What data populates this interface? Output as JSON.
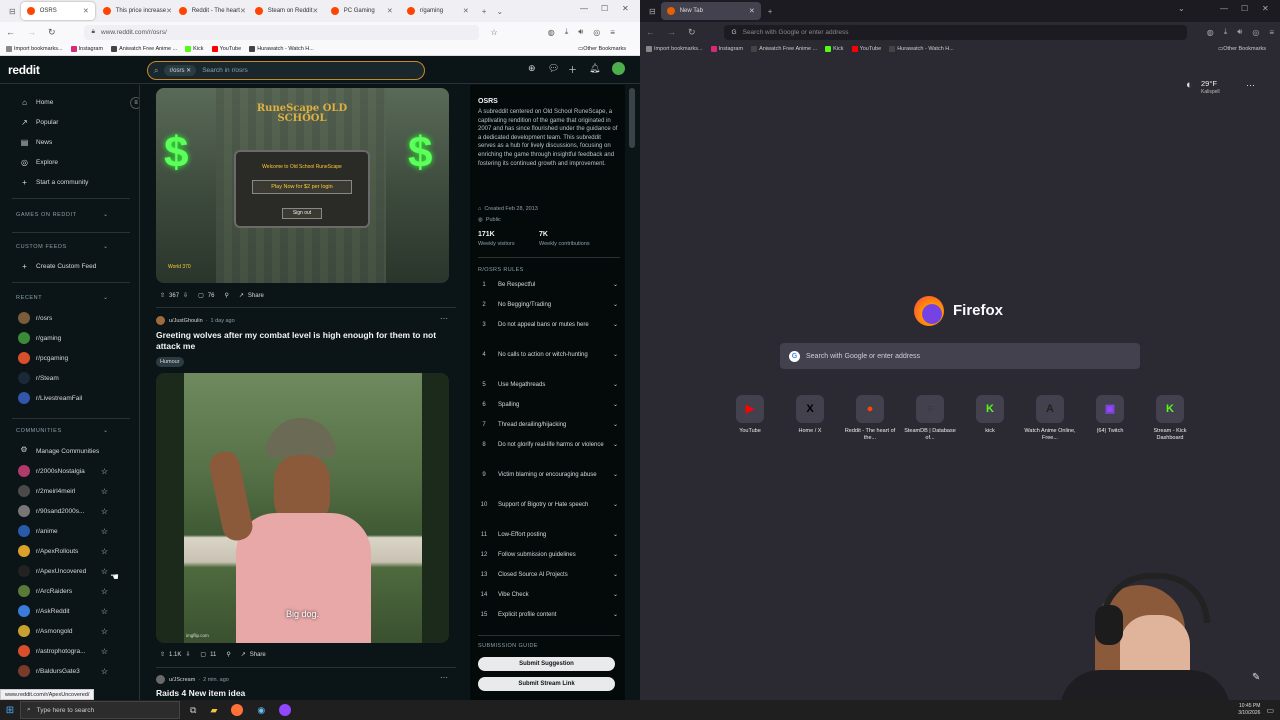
{
  "left_browser": {
    "tabs": [
      {
        "label": "OSRS",
        "active": true
      },
      {
        "label": "This price increase",
        "active": false
      },
      {
        "label": "Reddit - The heart",
        "active": false
      },
      {
        "label": "Steam on Reddit",
        "active": false
      },
      {
        "label": "PC Gaming",
        "active": false
      },
      {
        "label": "r/gaming",
        "active": false
      }
    ],
    "url": "www.reddit.com/r/osrs/",
    "bookmarks": [
      "Import bookmarks...",
      "Instagram",
      "Aniwatch Free Anime ...",
      "Kick",
      "YouTube",
      "Hurawatch - Watch H..."
    ],
    "other_bookmarks": "Other Bookmarks"
  },
  "reddit": {
    "logo": "reddit",
    "search_chip": "r/osrs",
    "search_placeholder": "Search in r/osrs",
    "nav": [
      {
        "label": "Home",
        "icon": "home-icon"
      },
      {
        "label": "Popular",
        "icon": "popular-icon"
      },
      {
        "label": "News",
        "icon": "news-icon"
      },
      {
        "label": "Explore",
        "icon": "explore-icon"
      },
      {
        "label": "Start a community",
        "icon": "plus-icon"
      }
    ],
    "sections": {
      "games": "GAMES ON REDDIT",
      "custom": "CUSTOM FEEDS",
      "create_feed": "Create Custom Feed",
      "recent": "RECENT",
      "communities": "COMMUNITIES",
      "manage": "Manage Communities"
    },
    "recent": [
      {
        "label": "r/osrs",
        "color": "#7a5c3a"
      },
      {
        "label": "r/gaming",
        "color": "#3a8a3a"
      },
      {
        "label": "r/pcgaming",
        "color": "#d94f2b"
      },
      {
        "label": "r/Steam",
        "color": "#1b2838"
      },
      {
        "label": "r/LivestreamFail",
        "color": "#3355aa"
      }
    ],
    "communities": [
      {
        "label": "r/2000sNostalgia",
        "color": "#b03a6a"
      },
      {
        "label": "r/2meirl4meirl",
        "color": "#4a4a4a"
      },
      {
        "label": "r/90sand2000s...",
        "color": "#777777"
      },
      {
        "label": "r/anime",
        "color": "#2a5aa8"
      },
      {
        "label": "r/ApexRollouts",
        "color": "#d9a02a"
      },
      {
        "label": "r/ApexUncovered",
        "color": "#222222"
      },
      {
        "label": "r/ArcRaiders",
        "color": "#5a7a3a"
      },
      {
        "label": "r/AskReddit",
        "color": "#3a7ad9"
      },
      {
        "label": "r/Asmongold",
        "color": "#c8a030"
      },
      {
        "label": "r/astrophotogra...",
        "color": "#d94f2b"
      },
      {
        "label": "r/BaldursGate3",
        "color": "#7a3a2a"
      }
    ],
    "post1": {
      "image_caption": "Welcome to Old School RuneScape",
      "image_button1": "Play Now for $2 per login",
      "image_button2": "Sign out",
      "image_logo": "RuneScape OLD SCHOOL",
      "image_world": "World 370",
      "votes": "367",
      "comments": "76",
      "share": "Share"
    },
    "post2": {
      "author": "u/JustGhoulin",
      "time": "1 day ago",
      "title": "Greeting wolves after my combat level is high enough for them to not attack me",
      "flair": "Humour",
      "video_caption": "Big dog.",
      "watermark": "imgflip.com",
      "votes": "1.1K",
      "comments": "11",
      "share": "Share"
    },
    "post3": {
      "author": "u/JScream",
      "time": "2 min. ago",
      "title": "Raids 4 New item idea"
    },
    "about": {
      "title": "OSRS",
      "description": "A subreddit centered on Old School RuneScape, a captivating rendition of the game that originated in 2007 and has since flourished under the guidance of a dedicated development team. This subreddit serves as a hub for lively discussions, focusing on enriching the game through insightful feedback and fostering its continued growth and improvement.",
      "created": "Created Feb 28, 2013",
      "visibility": "Public",
      "visitors_value": "171K",
      "visitors_label": "Weekly visitors",
      "contrib_value": "7K",
      "contrib_label": "Weekly contributions",
      "rules_title": "R/OSRS RULES",
      "submission_guide": "SUBMISSION GUIDE",
      "btn1": "Submit Suggestion",
      "btn2": "Submit Stream Link"
    },
    "rules": [
      {
        "n": "1",
        "t": "Be Respectful"
      },
      {
        "n": "2",
        "t": "No Begging/Trading"
      },
      {
        "n": "3",
        "t": "Do not appeal bans or mutes here"
      },
      {
        "n": "4",
        "t": "No calls to action or witch-hunting"
      },
      {
        "n": "5",
        "t": "Use Megathreads"
      },
      {
        "n": "6",
        "t": "Spalling"
      },
      {
        "n": "7",
        "t": "Thread derailing/hijacking"
      },
      {
        "n": "8",
        "t": "Do not glorify real-life harms or violence"
      },
      {
        "n": "9",
        "t": "Victim blaming or encouraging abuse"
      },
      {
        "n": "10",
        "t": "Support of Bigotry or Hate speech"
      },
      {
        "n": "11",
        "t": "Low-Effort posting"
      },
      {
        "n": "12",
        "t": "Follow submission guidelines"
      },
      {
        "n": "13",
        "t": "Closed Source AI Projects"
      },
      {
        "n": "14",
        "t": "Vibe Check"
      },
      {
        "n": "15",
        "t": "Explicit profile content"
      }
    ],
    "status_url": "www.reddit.com/r/ApexUncovered/"
  },
  "right_browser": {
    "tab": "New Tab",
    "url_placeholder": "Search with Google or enter address",
    "bookmarks": [
      "Import bookmarks...",
      "Instagram",
      "Aniwatch Free Anime ...",
      "Kick",
      "YouTube",
      "Hurawatch - Watch H..."
    ],
    "other_bookmarks": "Other Bookmarks",
    "weather_temp": "29°F",
    "weather_city": "Kalispell",
    "brand": "Firefox",
    "search_placeholder": "Search with Google or enter address",
    "shortcuts": [
      {
        "label": "YouTube",
        "glyph": "▶",
        "color": "#ff0000"
      },
      {
        "label": "Home / X",
        "glyph": "X",
        "color": "#000000"
      },
      {
        "label": "Reddit - The heart of the...",
        "glyph": "●",
        "color": "#ff4500"
      },
      {
        "label": "SteamDB | Database of...",
        "glyph": "≡",
        "color": "#3a3a3a"
      },
      {
        "label": "kick",
        "glyph": "K",
        "color": "#53fc18"
      },
      {
        "label": "Watch Anime Online, Free...",
        "glyph": "A",
        "color": "#222222"
      },
      {
        "label": "(64) Twitch",
        "glyph": "▣",
        "color": "#9146ff"
      },
      {
        "label": "Stream - Kick Dashboard",
        "glyph": "K",
        "color": "#53fc18"
      }
    ]
  },
  "taskbar": {
    "search_placeholder": "Type here to search",
    "time": "10:45 PM",
    "date": "3/10/2026"
  }
}
